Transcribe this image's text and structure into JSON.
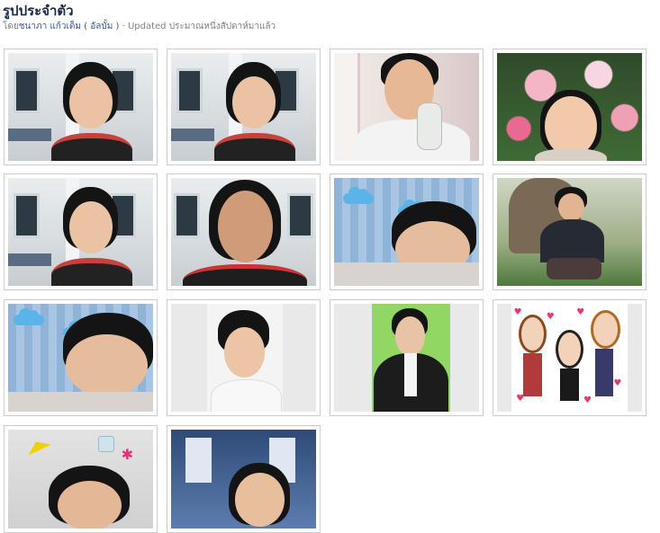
{
  "page": {
    "title": "รูปประจำตัว",
    "subtitle_prefix": "โดย",
    "author": "ชนาภา แก้วเต็ม",
    "album_link": "( อัลบั้ม )",
    "separator": "·",
    "updated": "Updated ประมาณหนึ่งสัปดาห์มาแล้ว"
  },
  "photos": [
    {
      "id": "p1",
      "scene": "classroom-girl"
    },
    {
      "id": "p2",
      "scene": "classroom-girl"
    },
    {
      "id": "p3",
      "scene": "boy-phone"
    },
    {
      "id": "p4",
      "scene": "girl-flowers"
    },
    {
      "id": "p5",
      "scene": "classroom-girl"
    },
    {
      "id": "p6",
      "scene": "girl-room"
    },
    {
      "id": "p7",
      "scene": "girl-clouds"
    },
    {
      "id": "p8",
      "scene": "boy-tree"
    },
    {
      "id": "p9",
      "scene": "girl-clouds"
    },
    {
      "id": "p10",
      "scene": "portrait-boy"
    },
    {
      "id": "p11",
      "scene": "suit-boy"
    },
    {
      "id": "p12",
      "scene": "chibi-anime"
    },
    {
      "id": "p13",
      "scene": "girl-stickers"
    },
    {
      "id": "p14",
      "scene": "girl-curtain"
    }
  ]
}
